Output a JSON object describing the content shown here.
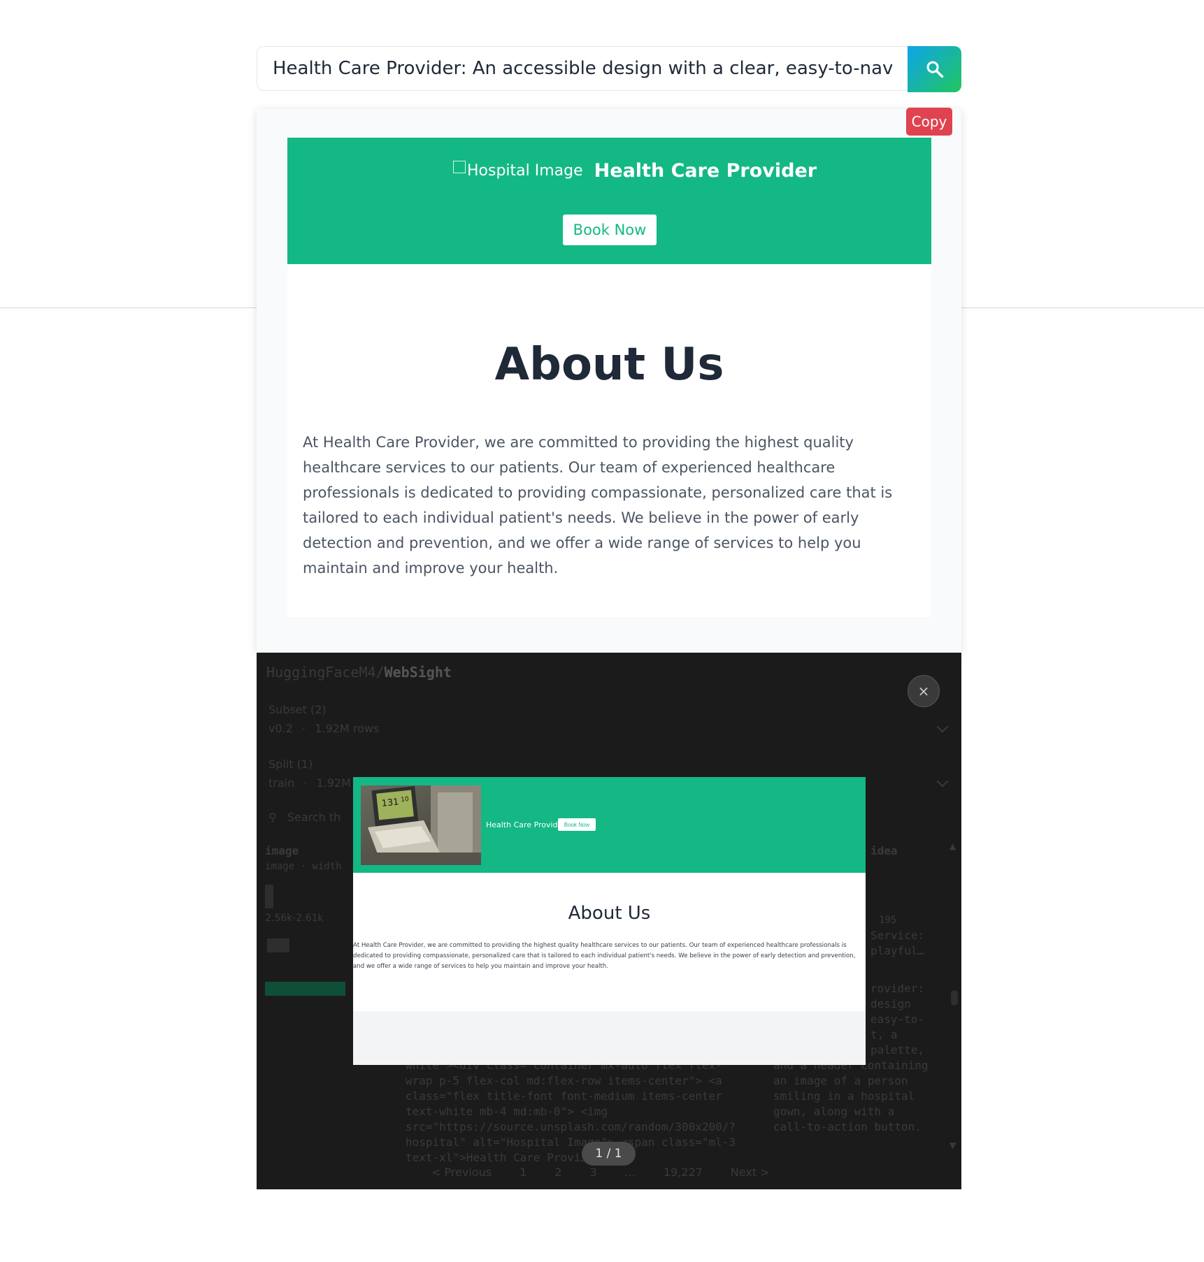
{
  "search": {
    "value": "Health Care Provider: An accessible design with a clear, easy-to-navigate l"
  },
  "copy_label": "Copy",
  "preview": {
    "image_alt": "Hospital Image",
    "brand_title": "Health Care Provider",
    "book_label": "Book Now",
    "about_title": "About Us",
    "about_text": "At Health Care Provider, we are committed to providing the highest quality healthcare services to our patients. Our team of experienced healthcare professionals is dedicated to providing compassionate, personalized care that is tailored to each individual patient's needs. We believe in the power of early detection and prevention, and we offer a wide range of services to help you maintain and improve your health."
  },
  "backdrop": {
    "org": "HuggingFaceM4",
    "dataset": "WebSight",
    "subset_label": "Subset (2)",
    "subset_value": "v0.2",
    "subset_rows": "1.92M rows",
    "split_label": "Split (1)",
    "split_value": "train",
    "split_rows": "1.92M",
    "search_placeholder": "Search th",
    "col_image": "image",
    "col_image_type": "image · width",
    "col_idea": "idea",
    "size_range": "2.56k-2.61k",
    "idea_count": "195",
    "idea_lines_1": [
      "Service:",
      "playful…"
    ],
    "idea_lines_2": [
      "rovider:",
      "design",
      "easy-to-",
      "t, a",
      "palette,",
      "and a header containing",
      "an image of a person",
      "smiling in a hospital",
      "gown, along with a",
      "call-to-action button."
    ],
    "code_lines": [
      "white\"><div class=\"container mx-auto flex flex-",
      "wrap p-5 flex-col md:flex-row items-center\"> <a",
      "class=\"flex title-font font-medium items-center",
      "text-white mb-4 md:mb-0\"> <img",
      "src=\"https://source.unsplash.com/random/300x200/?",
      "hospital\" alt=\"Hospital Image\"> <span class=\"ml-3",
      "text-xl\">Health Care Provi…"
    ],
    "pages": [
      "< Previous",
      "1",
      "2",
      "3",
      "...",
      "19,227",
      "Next >"
    ]
  },
  "close_symbol": "×",
  "modal": {
    "brand": "Health Care Provider",
    "book_label": "Book Now",
    "about_title": "About Us",
    "about_text": "At Health Care Provider, we are committed to providing the highest quality healthcare services to our patients. Our team of experienced healthcare professionals is dedicated to providing compassionate, personalized care that is tailored to each individual patient's needs. We believe in the power of early detection and prevention, and we offer a wide range of services to help you maintain and improve your health."
  },
  "image_counter": "1 / 1",
  "colors": {
    "brand_green": "#13b885",
    "copy_red": "#e0424f",
    "dark_bg": "#1b1b1b"
  }
}
